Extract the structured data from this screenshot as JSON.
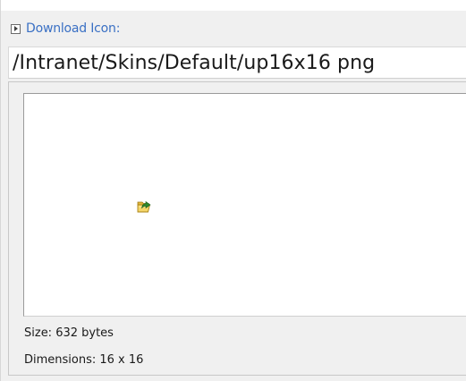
{
  "header": {
    "label": "Download Icon:",
    "expander_icon": "triangle-right-icon"
  },
  "path_field": {
    "value": "/Intranet/Skins/Default/up16x16 png"
  },
  "preview": {
    "icon": "folder-up-icon",
    "size_text": "Size: 632 bytes",
    "dimensions_text": "Dimensions: 16 x 16"
  },
  "colors": {
    "link_blue": "#3a70c4",
    "panel_bg": "#f0f0f0",
    "folder_yellow": "#f2c94c",
    "arrow_green": "#2f8a2f"
  }
}
